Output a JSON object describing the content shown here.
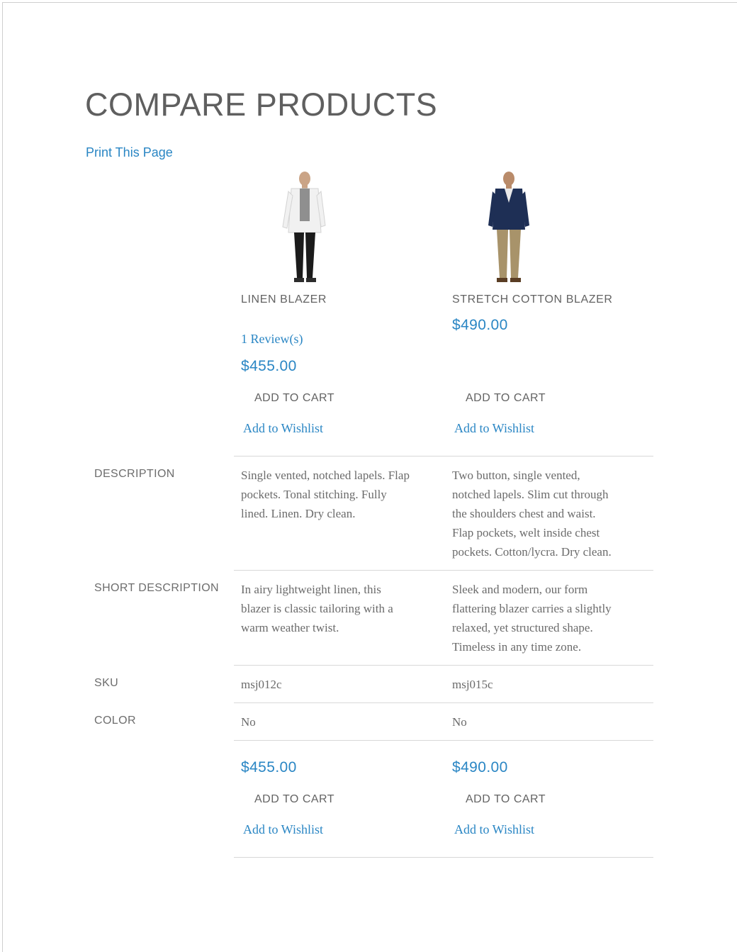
{
  "page": {
    "title": "COMPARE PRODUCTS",
    "print_link": "Print This Page"
  },
  "products": [
    {
      "name": "LINEN BLAZER",
      "reviews": "1 Review(s)",
      "price": "$455.00",
      "add_to_cart": "ADD TO CART",
      "add_to_wishlist": "Add to Wishlist",
      "image": {
        "icon": "product-photo-icon",
        "jacket_color": "#f1f1f1",
        "shirt_color": "#8f8f8f",
        "pants_color": "#1b1b1b"
      }
    },
    {
      "name": "STRETCH COTTON BLAZER",
      "price": "$490.00",
      "add_to_cart": "ADD TO CART",
      "add_to_wishlist": "Add to Wishlist",
      "image": {
        "icon": "product-photo-icon",
        "jacket_color": "#1e2f55",
        "shirt_color": "#e9e9e9",
        "pants_color": "#a8936a"
      }
    }
  ],
  "attributes": {
    "description": {
      "label": "DESCRIPTION",
      "values": [
        [
          "Single vented, notched lapels. Flap",
          "pockets. Tonal stitching. Fully",
          "lined. Linen. Dry clean."
        ],
        [
          "Two button, single vented,",
          "notched lapels. Slim cut through",
          "the shoulders chest and waist.",
          "Flap pockets, welt inside chest",
          "pockets. Cotton/lycra. Dry clean."
        ]
      ]
    },
    "short_description": {
      "label": "SHORT DESCRIPTION",
      "values": [
        [
          "In airy lightweight linen, this",
          "blazer is classic tailoring with a",
          "warm weather twist."
        ],
        [
          "Sleek and modern, our form",
          "flattering blazer carries a slightly",
          "relaxed, yet structured shape.",
          "Timeless in any time zone."
        ]
      ]
    },
    "sku": {
      "label": "SKU",
      "values": [
        "msj012c",
        "msj015c"
      ]
    },
    "color": {
      "label": "COLOR",
      "values": [
        "No",
        "No"
      ]
    }
  },
  "footer_row": [
    {
      "price": "$455.00",
      "add_to_cart": "ADD TO CART",
      "add_to_wishlist": "Add to Wishlist"
    },
    {
      "price": "$490.00",
      "add_to_cart": "ADD TO CART",
      "add_to_wishlist": "Add to Wishlist"
    }
  ],
  "colors": {
    "accent": "#2a86c4",
    "text": "#636363",
    "rule": "#d8d8d8"
  }
}
